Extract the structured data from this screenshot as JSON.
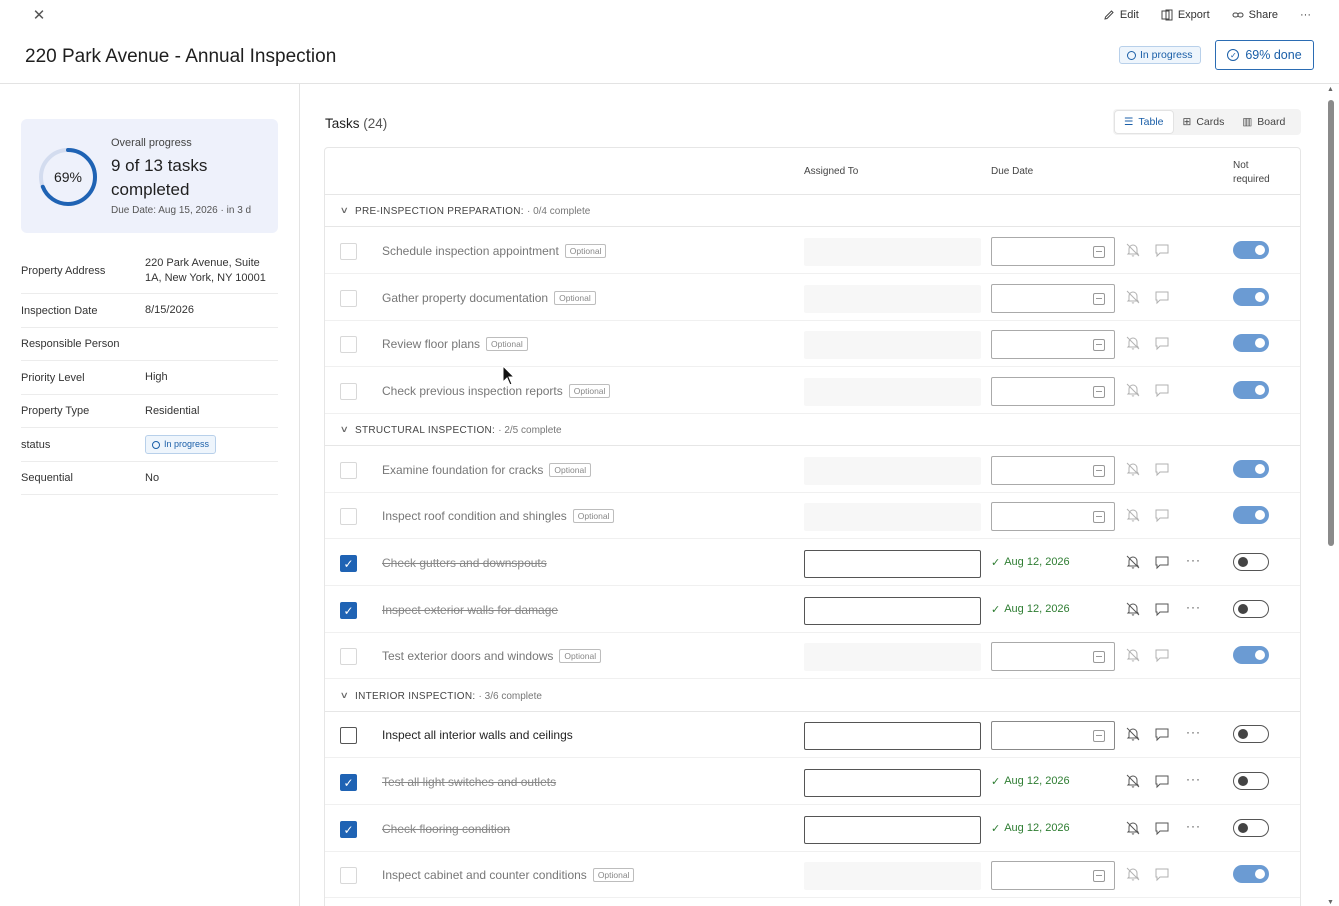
{
  "header": {
    "title": "220 Park Avenue - Annual Inspection",
    "status": "In progress",
    "done_label": "69% done",
    "edit": "Edit",
    "export": "Export",
    "share": "Share",
    "more": "···"
  },
  "summary": {
    "percent": "69%",
    "percent_value": 0.69,
    "label": "Overall progress",
    "main": "9 of 13 tasks completed",
    "due": "Due Date: Aug 15, 2026 · in 3 d"
  },
  "properties": [
    {
      "key": "Property Address",
      "value": "220 Park Avenue, Suite 1A, New York, NY 10001"
    },
    {
      "key": "Inspection Date",
      "value": "8/15/2026"
    },
    {
      "key": "Responsible Person",
      "value": ""
    },
    {
      "key": "Priority Level",
      "value": "High"
    },
    {
      "key": "Property Type",
      "value": "Residential"
    },
    {
      "key": "status",
      "value": "In progress"
    },
    {
      "key": "Sequential",
      "value": "No"
    }
  ],
  "tasks": {
    "title": "Tasks",
    "count": "(24)",
    "views": [
      "Table",
      "Cards",
      "Board"
    ],
    "columns": {
      "assigned": "Assigned To",
      "due": "Due Date",
      "not_required": "Not required"
    },
    "groups": [
      {
        "name": "PRE-INSPECTION PREPARATION:",
        "sub": "· 0/4 complete"
      },
      {
        "name": "STRUCTURAL INSPECTION:",
        "sub": "· 2/5 complete"
      },
      {
        "name": "INTERIOR INSPECTION:",
        "sub": "· 3/6 complete"
      }
    ],
    "optional_label": "Optional",
    "rows": [
      {
        "name": "Schedule inspection appointment",
        "state": "optional"
      },
      {
        "name": "Gather property documentation",
        "state": "optional"
      },
      {
        "name": "Review floor plans",
        "state": "optional"
      },
      {
        "name": "Check previous inspection reports",
        "state": "optional"
      },
      {
        "name": "Examine foundation for cracks",
        "state": "optional"
      },
      {
        "name": "Inspect roof condition and shingles",
        "state": "optional"
      },
      {
        "name": "Check gutters and downspouts",
        "state": "done",
        "due": "Aug 12, 2026"
      },
      {
        "name": "Inspect exterior walls for damage",
        "state": "done",
        "due": "Aug 12, 2026"
      },
      {
        "name": "Test exterior doors and windows",
        "state": "optional"
      },
      {
        "name": "Inspect all interior walls and ceilings",
        "state": "open"
      },
      {
        "name": "Test all light switches and outlets",
        "state": "done",
        "due": "Aug 12, 2026"
      },
      {
        "name": "Check flooring condition",
        "state": "done",
        "due": "Aug 12, 2026"
      },
      {
        "name": "Inspect cabinet and counter conditions",
        "state": "optional"
      }
    ]
  },
  "colors": {
    "accent": "#1f63b4",
    "done_green": "#2e7d32",
    "toggle_on": "#6b9bd3"
  }
}
